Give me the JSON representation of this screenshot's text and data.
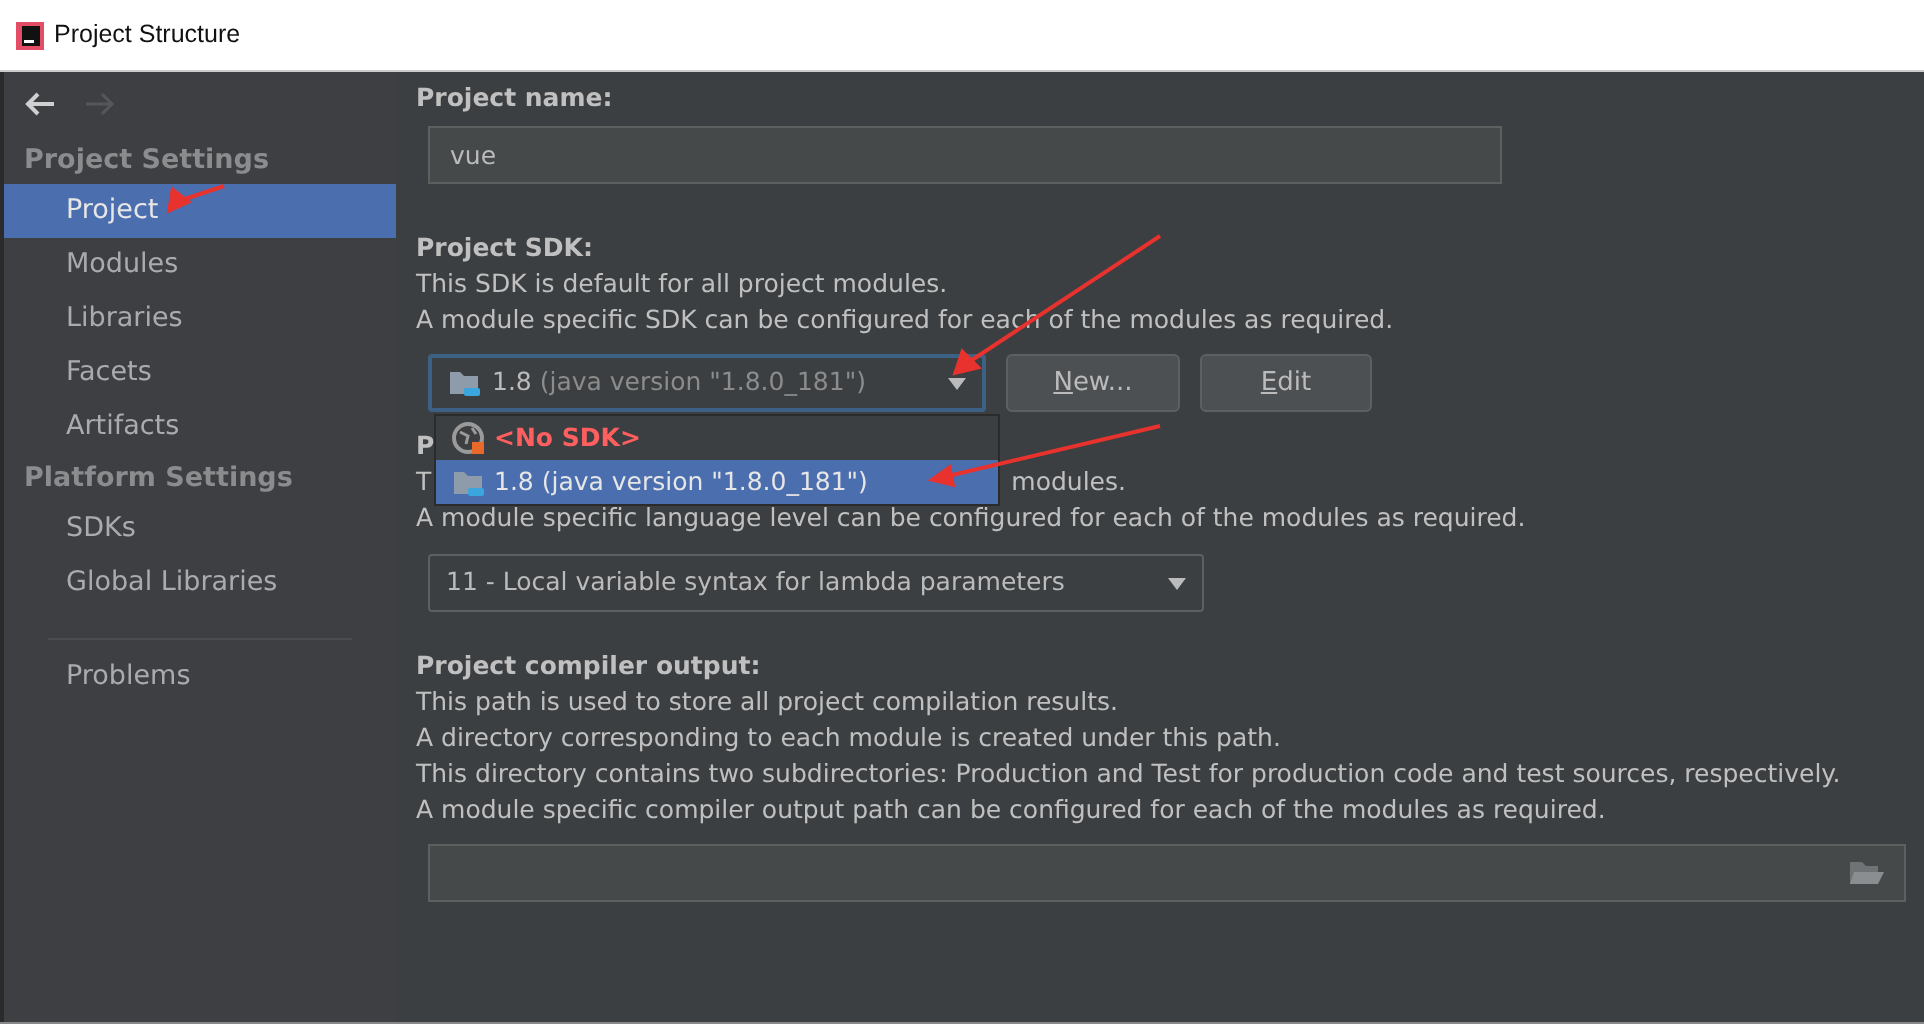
{
  "window": {
    "title": "Project Structure"
  },
  "sidebar": {
    "nav": {
      "back_enabled": true,
      "forward_enabled": false
    },
    "groups": [
      {
        "heading": "Project Settings",
        "items": [
          {
            "label": "Project",
            "selected": true
          },
          {
            "label": "Modules",
            "selected": false
          },
          {
            "label": "Libraries",
            "selected": false
          },
          {
            "label": "Facets",
            "selected": false
          },
          {
            "label": "Artifacts",
            "selected": false
          }
        ]
      },
      {
        "heading": "Platform Settings",
        "items": [
          {
            "label": "SDKs",
            "selected": false
          },
          {
            "label": "Global Libraries",
            "selected": false
          }
        ]
      }
    ],
    "footer_items": [
      {
        "label": "Problems",
        "selected": false
      }
    ]
  },
  "project_name": {
    "label": "Project name:",
    "value": "vue"
  },
  "project_sdk": {
    "label": "Project SDK:",
    "lines": [
      "This SDK is default for all project modules.",
      "A module specific SDK can be configured for each of the modules as required."
    ],
    "combo": {
      "version": "1.8",
      "detail": "(java version \"1.8.0_181\")",
      "focused": true
    },
    "buttons": [
      {
        "label": "New..."
      },
      {
        "label": "Edit"
      }
    ],
    "popup": [
      {
        "kind": "none",
        "label": "<No SDK>",
        "selected": false
      },
      {
        "kind": "jdk",
        "label": "1.8 (java version \"1.8.0_181\")",
        "selected": true
      }
    ]
  },
  "language_level": {
    "label_visible": "P",
    "line_1_start": "T",
    "line_1_end": "modules.",
    "line_2": "A module specific language level can be configured for each of the modules as required.",
    "combo": {
      "value": "11 - Local variable syntax for lambda parameters"
    }
  },
  "compiler_output": {
    "label": "Project compiler output:",
    "lines": [
      "This path is used to store all project compilation results.",
      "A directory corresponding to each module is created under this path.",
      "This directory contains two subdirectories: Production and Test for production code and test sources, respectively.",
      "A module specific compiler output path can be configured for each of the modules as required."
    ]
  }
}
